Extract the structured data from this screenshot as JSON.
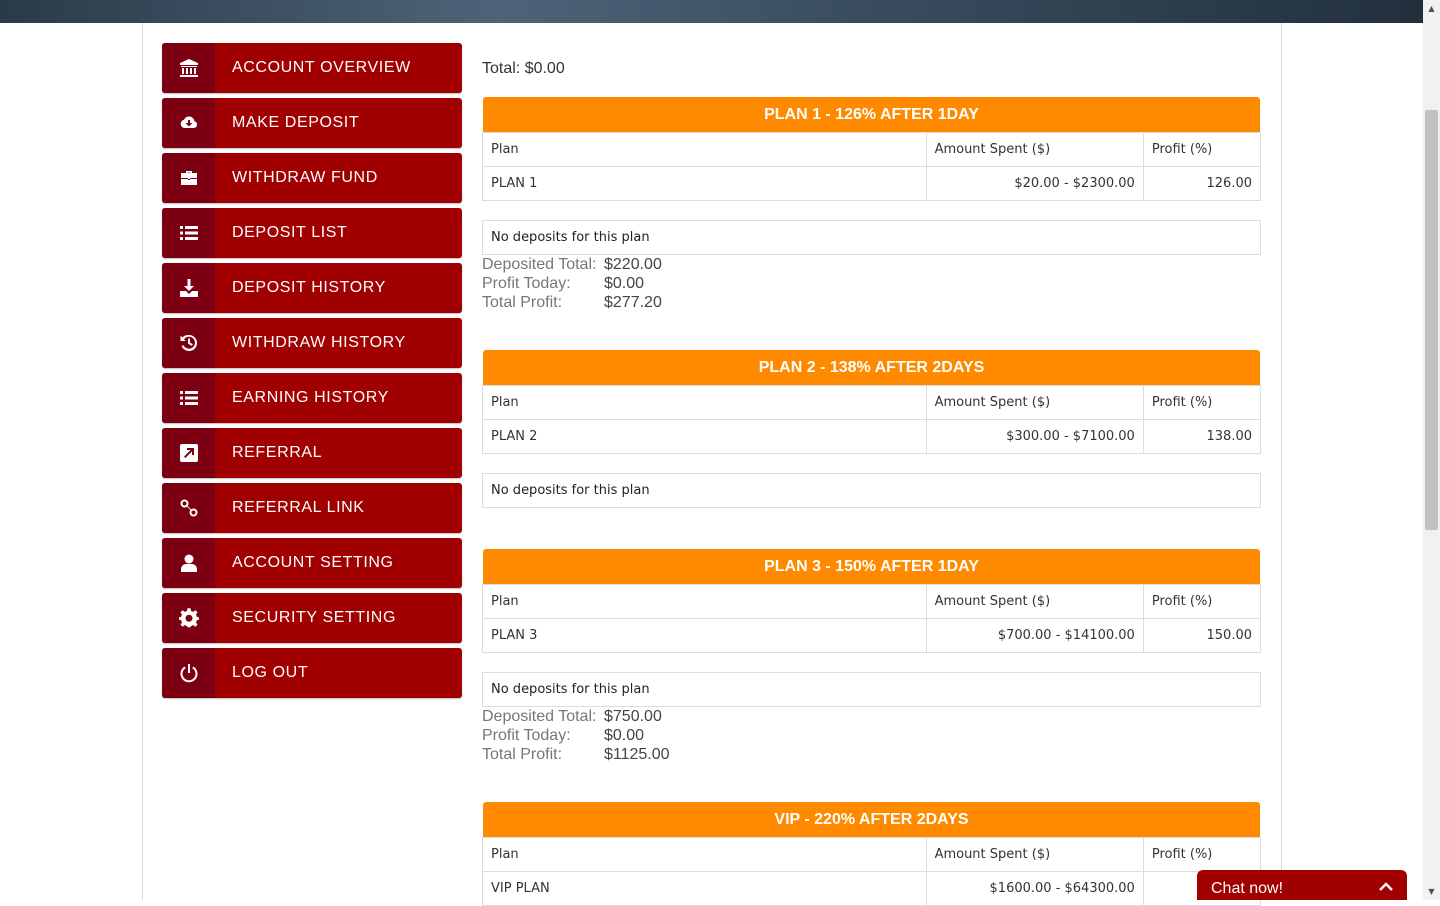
{
  "banner": {
    "text": ""
  },
  "sidebar": {
    "items": [
      {
        "label": "ACCOUNT OVERVIEW",
        "icon": "bank-icon"
      },
      {
        "label": "MAKE DEPOSIT",
        "icon": "cloud-download-icon"
      },
      {
        "label": "WITHDRAW FUND",
        "icon": "briefcase-icon"
      },
      {
        "label": "DEPOSIT LIST",
        "icon": "list-icon"
      },
      {
        "label": "DEPOSIT HISTORY",
        "icon": "download-icon"
      },
      {
        "label": "WITHDRAW HISTORY",
        "icon": "history-icon"
      },
      {
        "label": "EARNING HISTORY",
        "icon": "list-icon"
      },
      {
        "label": "REFERRAL",
        "icon": "external-link-icon"
      },
      {
        "label": "REFERRAL LINK",
        "icon": "link-icon"
      },
      {
        "label": "ACCOUNT SETTING",
        "icon": "user-icon"
      },
      {
        "label": "SECURITY SETTING",
        "icon": "gear-icon"
      },
      {
        "label": "LOG OUT",
        "icon": "power-icon"
      }
    ],
    "colors": {
      "item_bg": "#a10000",
      "icon_bg": "#7d0012"
    }
  },
  "main": {
    "total": "Total: $0.00",
    "plan_header_color": "#ff8a00",
    "columns": {
      "plan": "Plan",
      "amount": "Amount Spent ($)",
      "profit": "Profit (%)"
    },
    "no_deposits": "No deposits for this plan",
    "stat_labels": {
      "deposited": "Deposited Total:",
      "today": "Profit Today:",
      "total": "Total Profit:"
    },
    "plans": [
      {
        "title": "PLAN 1 - 126% AFTER 1DAY",
        "name": "PLAN 1",
        "amount": "$20.00 - $2300.00",
        "profit": "126.00",
        "stats": {
          "deposited": "$220.00",
          "today": "$0.00",
          "total": "$277.20"
        }
      },
      {
        "title": "PLAN 2 - 138% AFTER 2DAYS",
        "name": "PLAN 2",
        "amount": "$300.00 - $7100.00",
        "profit": "138.00"
      },
      {
        "title": "PLAN 3 - 150% AFTER 1DAY",
        "name": "PLAN 3",
        "amount": "$700.00 - $14100.00",
        "profit": "150.00",
        "stats": {
          "deposited": "$750.00",
          "today": "$0.00",
          "total": "$1125.00"
        }
      },
      {
        "title": "VIP - 220% AFTER 2DAYS",
        "name": "VIP PLAN",
        "amount": "$1600.00 - $64300.00",
        "profit": ""
      }
    ]
  },
  "chat": {
    "label": "Chat now!"
  }
}
